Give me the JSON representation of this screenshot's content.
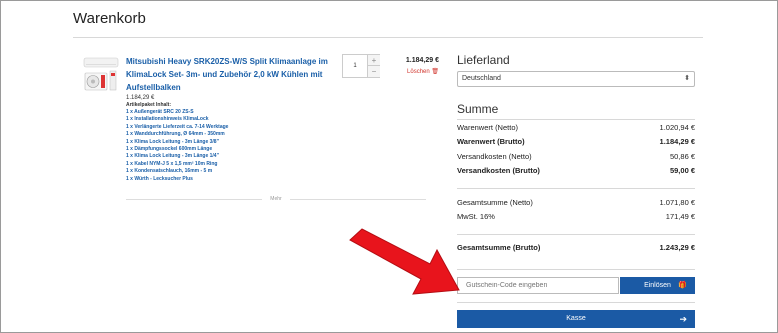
{
  "page": {
    "title": "Warenkorb"
  },
  "cart": {
    "product": {
      "name": "Mitsubishi Heavy SRK20ZS-W/S Split Klimaanlage im KlimaLock Set- 3m- und Zubehör 2,0 kW Kühlen mit Aufstellbalken",
      "unit_price": "1.184,29 €",
      "kit_title": "Artikelpaket Inhalt:",
      "kit_items": [
        "1 x Außengerät SRC 20 ZS-S",
        "1 x Installationshinweis KlimaLock",
        "1 x Verlängerte Lieferzeit ca. 7-14 Werktage",
        "1 x Wanddurchführung, Ø 64mm - 350mm",
        "1 x Klima Lock Leitung - 3m Länge 3/8\"",
        "1 x Dämpfungssockel 600mm Länge",
        "1 x Klima Lock Leitung - 3m Länge 1/4\"",
        "1 x Kabel NYM-J 5 x 1,5 mm² 10m Ring",
        "1 x Kondensatschlauch, 16mm - 5 m",
        "1 x Würth - Lecksucher Plus"
      ],
      "quantity": "1",
      "qty_plus": "+",
      "qty_minus": "−",
      "line_price": "1.184,29 €",
      "delete_label": "Löschen",
      "more_label": "Mehr"
    }
  },
  "delivery": {
    "title": "Lieferland",
    "country": "Deutschland"
  },
  "summary": {
    "title": "Summe",
    "rows": [
      {
        "label": "Warenwert (Netto)",
        "value": "1.020,94 €"
      },
      {
        "label": "Warenwert (Brutto)",
        "value": "1.184,29 €"
      },
      {
        "label": "Versandkosten (Netto)",
        "value": "50,86 €"
      },
      {
        "label": "Versandkosten (Brutto)",
        "value": "59,00 €"
      },
      {
        "label": "Gesamtsumme (Netto)",
        "value": "1.071,80 €"
      },
      {
        "label": "MwSt. 16%",
        "value": "171,49 €"
      },
      {
        "label": "Gesamtsumme (Brutto)",
        "value": "1.243,29 €"
      }
    ]
  },
  "voucher": {
    "placeholder": "Gutschein-Code eingeben",
    "button_label": "Einlösen"
  },
  "checkout": {
    "button_label": "Kasse"
  },
  "colors": {
    "accent": "#1b5aa5",
    "link": "#1a5fa8",
    "danger": "#d0342c",
    "annotation_arrow": "#e8141c"
  },
  "icons": [
    "gift-icon",
    "arrow-right-icon",
    "trash-icon",
    "chevron-updown-icon"
  ]
}
